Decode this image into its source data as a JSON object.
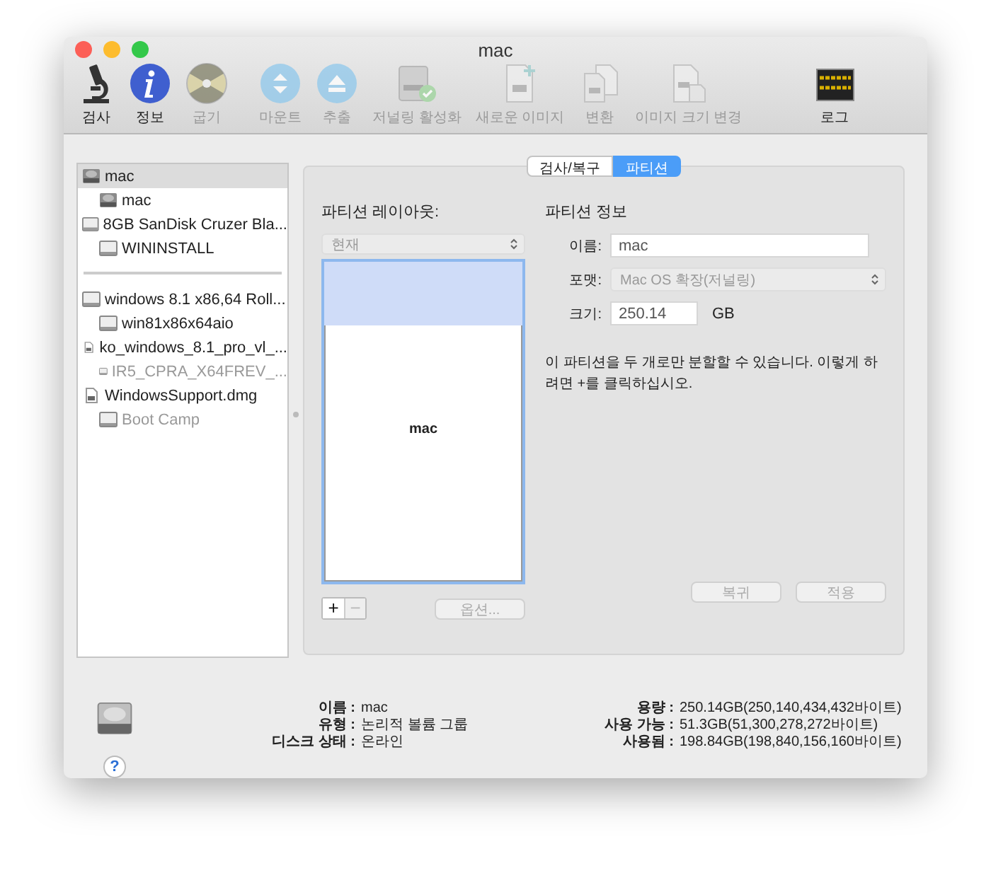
{
  "window": {
    "title": "mac"
  },
  "toolbar": [
    {
      "kind": "inspect",
      "label": "검사",
      "disabled": false
    },
    {
      "kind": "info",
      "label": "정보",
      "disabled": false
    },
    {
      "kind": "burn",
      "label": "굽기",
      "disabled": true
    },
    {
      "kind": "mount",
      "label": "마운트",
      "disabled": true
    },
    {
      "kind": "eject",
      "label": "추출",
      "disabled": true
    },
    {
      "kind": "journal",
      "label": "저널링 활성화",
      "disabled": true
    },
    {
      "kind": "new-image",
      "label": "새로운 이미지",
      "disabled": true
    },
    {
      "kind": "convert",
      "label": "변환",
      "disabled": true
    },
    {
      "kind": "resize",
      "label": "이미지 크기 변경",
      "disabled": true
    },
    {
      "kind": "log",
      "label": "로그",
      "disabled": false
    }
  ],
  "sidebar": {
    "groups": [
      [
        {
          "kind": "internal",
          "label": "mac",
          "selected": true,
          "disabled": false,
          "children": [
            {
              "kind": "internal",
              "label": "mac",
              "selected": false,
              "disabled": false
            }
          ]
        },
        {
          "kind": "external",
          "label": "8GB SanDisk Cruzer Bla...",
          "selected": false,
          "disabled": false,
          "children": [
            {
              "kind": "external",
              "label": "WININSTALL",
              "selected": false,
              "disabled": false
            }
          ]
        }
      ],
      [
        {
          "kind": "external",
          "label": "windows 8.1 x86,64 Roll...",
          "selected": false,
          "disabled": false,
          "children": [
            {
              "kind": "external",
              "label": "win81x86x64aio",
              "selected": false,
              "disabled": false
            }
          ]
        },
        {
          "kind": "file",
          "label": "ko_windows_8.1_pro_vl_...",
          "selected": false,
          "disabled": false,
          "children": [
            {
              "kind": "external",
              "label": "IR5_CPRA_X64FREV_...",
              "selected": false,
              "disabled": true
            }
          ]
        },
        {
          "kind": "file",
          "label": "WindowsSupport.dmg",
          "selected": false,
          "disabled": false,
          "children": [
            {
              "kind": "external",
              "label": "Boot Camp",
              "selected": false,
              "disabled": true
            }
          ]
        }
      ]
    ]
  },
  "tabs": [
    {
      "label": "검사/복구",
      "selected": false
    },
    {
      "label": "파티션",
      "selected": true
    }
  ],
  "layout": {
    "title": "파티션 레이아웃:",
    "scheme": "현재",
    "scheme_disabled": true,
    "partition": {
      "label": "mac",
      "level": 0.2
    },
    "buttons": [
      {
        "label": "+",
        "disabled": false
      },
      {
        "label": "−",
        "disabled": true
      }
    ],
    "options": {
      "label": "옵션...",
      "disabled": true
    }
  },
  "info": {
    "title": "파티션 정보",
    "name": {
      "label": "이름:",
      "value": "mac"
    },
    "format": {
      "label": "포맷:",
      "value": "Mac OS 확장(저널링)",
      "disabled": true
    },
    "size": {
      "label": "크기:",
      "value": "250.14",
      "unit": "GB"
    },
    "note": "이 파티션을 두 개로만 분할할 수 있습니다. 이렇게 하려면 +를 클릭하십시오."
  },
  "actions": [
    {
      "label": "복귀",
      "disabled": true
    },
    {
      "label": "적용",
      "disabled": true
    }
  ],
  "details": {
    "left": [
      {
        "label": "이름 :",
        "value": "mac"
      },
      {
        "label": "유형 :",
        "value": "논리적 볼륨 그룹"
      },
      {
        "label": "디스크 상태 :",
        "value": "온라인"
      }
    ],
    "right": [
      {
        "label": "용량 :",
        "value": "250.14GB(250,140,434,432바이트)"
      },
      {
        "label": "사용 가능 :",
        "value": "51.3GB(51,300,278,272바이트)"
      },
      {
        "label": "사용됨 :",
        "value": "198.84GB(198,840,156,160바이트)"
      }
    ],
    "help": "?"
  }
}
